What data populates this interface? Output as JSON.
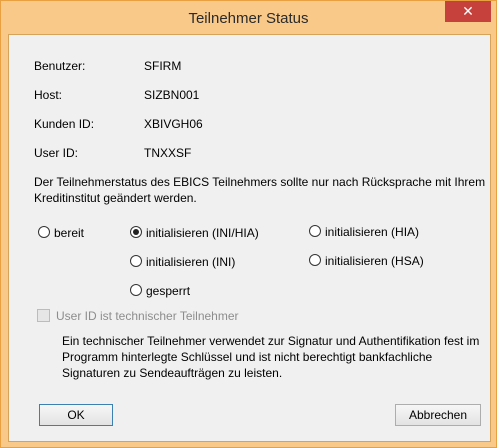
{
  "window": {
    "title": "Teilnehmer Status",
    "close_glyph": "✕"
  },
  "fields": [
    {
      "label": "Benutzer:",
      "value": "SFIRM"
    },
    {
      "label": "Host:",
      "value": "SIZBN001"
    },
    {
      "label": "Kunden ID:",
      "value": "XBIVGH06"
    },
    {
      "label": "User ID:",
      "value": "TNXXSF"
    }
  ],
  "info_text": "Der Teilnehmerstatus des EBICS Teilnehmers sollte nur nach Rücksprache mit Ihrem Kreditinstitut geändert werden.",
  "status_options": {
    "bereit": "bereit",
    "init_ini_hia": "initialisieren (INI/HIA)",
    "init_hia": "initialisieren (HIA)",
    "init_ini": "initialisieren (INI)",
    "init_hsa": "initialisieren (HSA)",
    "gesperrt": "gesperrt",
    "selected": "init_ini_hia"
  },
  "technical_checkbox": {
    "label": "User ID ist technischer Teilnehmer",
    "checked": false,
    "enabled": false
  },
  "technical_description": "Ein technischer Teilnehmer verwendet zur Signatur und Authentifikation fest im Programm hinterlegte Schlüssel und ist nicht berechtigt bankfachliche Signaturen zu Sendeaufträgen zu leisten.",
  "buttons": {
    "ok": "OK",
    "cancel": "Abbrechen"
  },
  "colors": {
    "frame": "#f9c98a",
    "close_button": "#c7413c",
    "client_bg": "#f0f0f0"
  }
}
